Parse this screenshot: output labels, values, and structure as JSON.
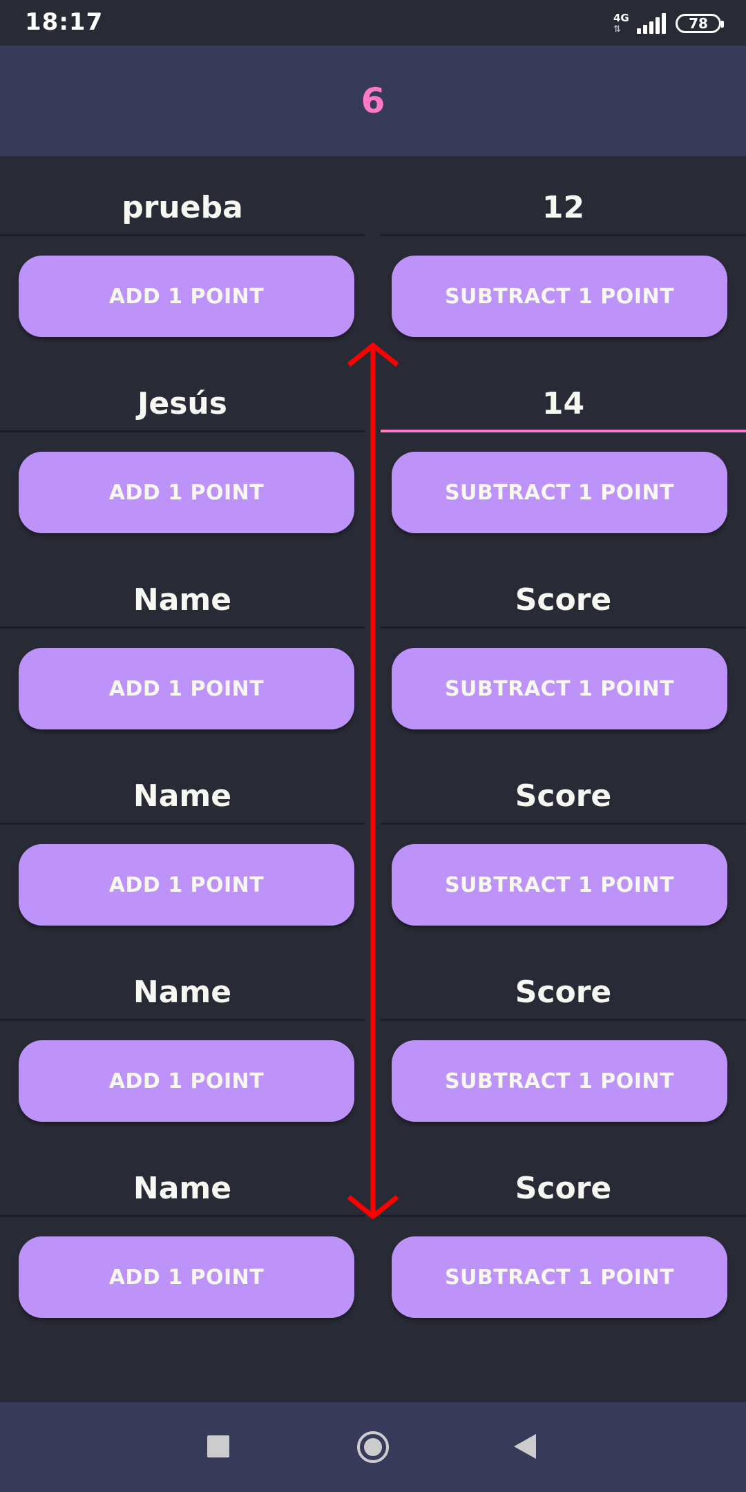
{
  "status_bar": {
    "time": "18:17",
    "network": "4G",
    "battery": "78"
  },
  "header": {
    "count": "6"
  },
  "players": [
    {
      "name": "prueba",
      "score": "12",
      "add_label": "ADD 1 POINT",
      "subtract_label": "SUBTRACT 1 POINT"
    },
    {
      "name": "Jesús",
      "score": "14",
      "add_label": "ADD 1 POINT",
      "subtract_label": "SUBTRACT 1 POINT"
    },
    {
      "name": "Name",
      "score": "Score",
      "add_label": "ADD 1 POINT",
      "subtract_label": "SUBTRACT 1 POINT"
    },
    {
      "name": "Name",
      "score": "Score",
      "add_label": "ADD 1 POINT",
      "subtract_label": "SUBTRACT 1 POINT"
    },
    {
      "name": "Name",
      "score": "Score",
      "add_label": "ADD 1 POINT",
      "subtract_label": "SUBTRACT 1 POINT"
    },
    {
      "name": "Name",
      "score": "Score",
      "add_label": "ADD 1 POINT",
      "subtract_label": "SUBTRACT 1 POINT"
    }
  ],
  "colors": {
    "background": "#282a36",
    "header": "#383a59",
    "accent": "#ff79c6",
    "button": "#bd93f9",
    "annotation": "#ff0000"
  },
  "icons": {
    "signal": "signal-strength-icon",
    "battery": "battery-icon",
    "scroll": "vertical-double-arrow-icon",
    "nav_recent": "square-icon",
    "nav_home": "circle-icon",
    "nav_back": "triangle-back-icon"
  }
}
